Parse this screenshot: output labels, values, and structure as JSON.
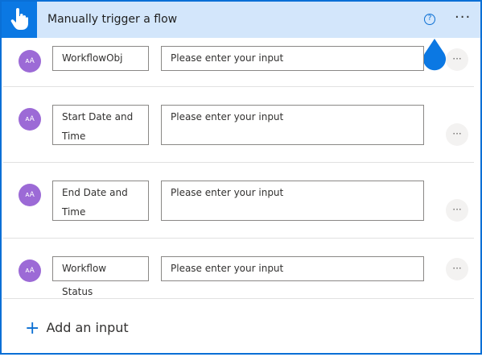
{
  "header": {
    "title": "Manually trigger a flow",
    "help_glyph": "?",
    "more_glyph": "···"
  },
  "inputs": [
    {
      "avatar_text": "ᴀA",
      "name": "WorkflowObj",
      "placeholder": "Please enter your input",
      "more_glyph": "···"
    },
    {
      "avatar_text": "ᴀA",
      "name": "Start Date and Time",
      "placeholder": "Please enter your input",
      "more_glyph": "···"
    },
    {
      "avatar_text": "ᴀA",
      "name": "End Date and Time",
      "placeholder": "Please enter your input",
      "more_glyph": "···"
    },
    {
      "avatar_text": "ᴀA",
      "name": "Workflow Status",
      "placeholder": "Please enter your input",
      "more_glyph": "···"
    }
  ],
  "add_input": {
    "icon": "+",
    "label": "Add an input"
  },
  "colors": {
    "accent": "#0b78e3",
    "header_bg": "#d3e6fb",
    "avatar": "#9c6ad6"
  }
}
